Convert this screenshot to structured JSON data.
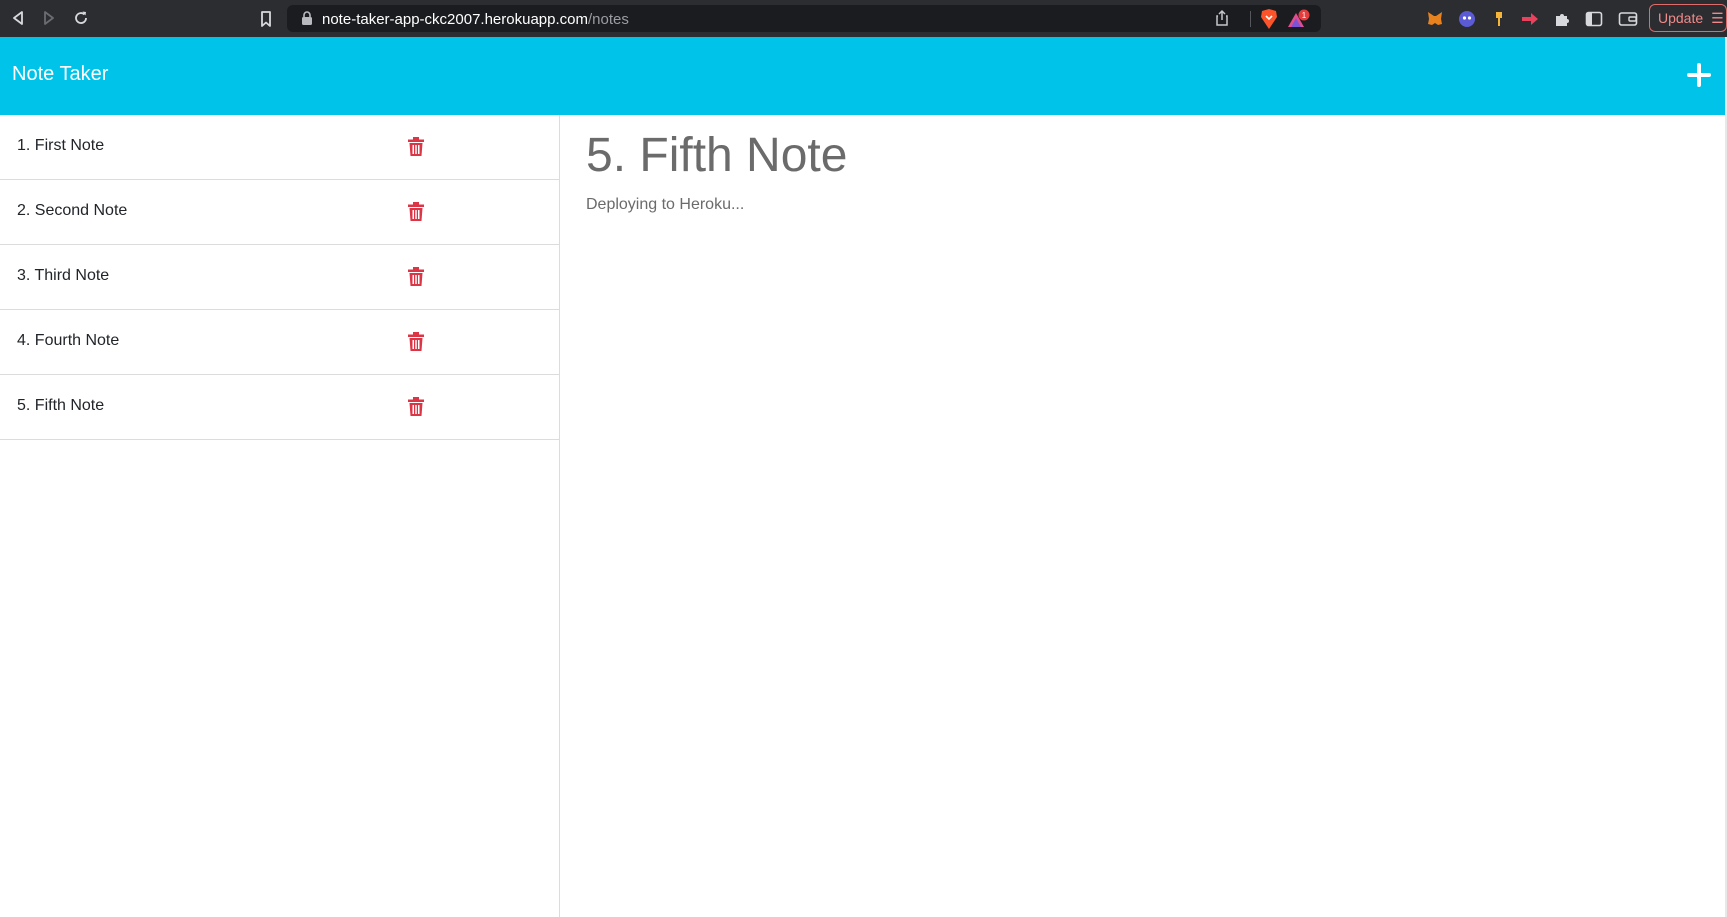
{
  "browser": {
    "url_host": "note-taker-app-ckc2007.herokuapp.com",
    "url_path": "/notes",
    "rewards_badge": "1",
    "update_label": "Update"
  },
  "app": {
    "title": "Note Taker",
    "accent_color": "#00c3ea",
    "delete_color": "#dc3545"
  },
  "notes": [
    {
      "title": "1. First Note"
    },
    {
      "title": "2. Second Note"
    },
    {
      "title": "3. Third Note"
    },
    {
      "title": "4. Fourth Note"
    },
    {
      "title": "5. Fifth Note"
    }
  ],
  "active_note": {
    "title": "5. Fifth Note",
    "text": "Deploying to Heroku..."
  }
}
